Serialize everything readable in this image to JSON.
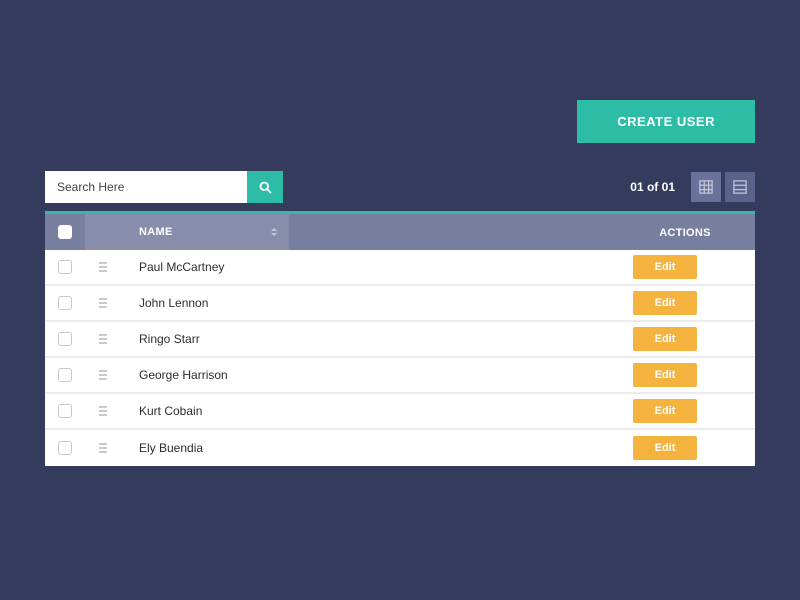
{
  "create_label": "CREATE USER",
  "search": {
    "placeholder": "Search Here"
  },
  "page_info": "01 of 01",
  "columns": {
    "name": "NAME",
    "actions": "ACTIONS"
  },
  "edit_label": "Edit",
  "rows": [
    {
      "name": "Paul McCartney"
    },
    {
      "name": "John Lennon"
    },
    {
      "name": "Ringo Starr"
    },
    {
      "name": "George Harrison"
    },
    {
      "name": "Kurt Cobain"
    },
    {
      "name": "Ely Buendia"
    }
  ]
}
